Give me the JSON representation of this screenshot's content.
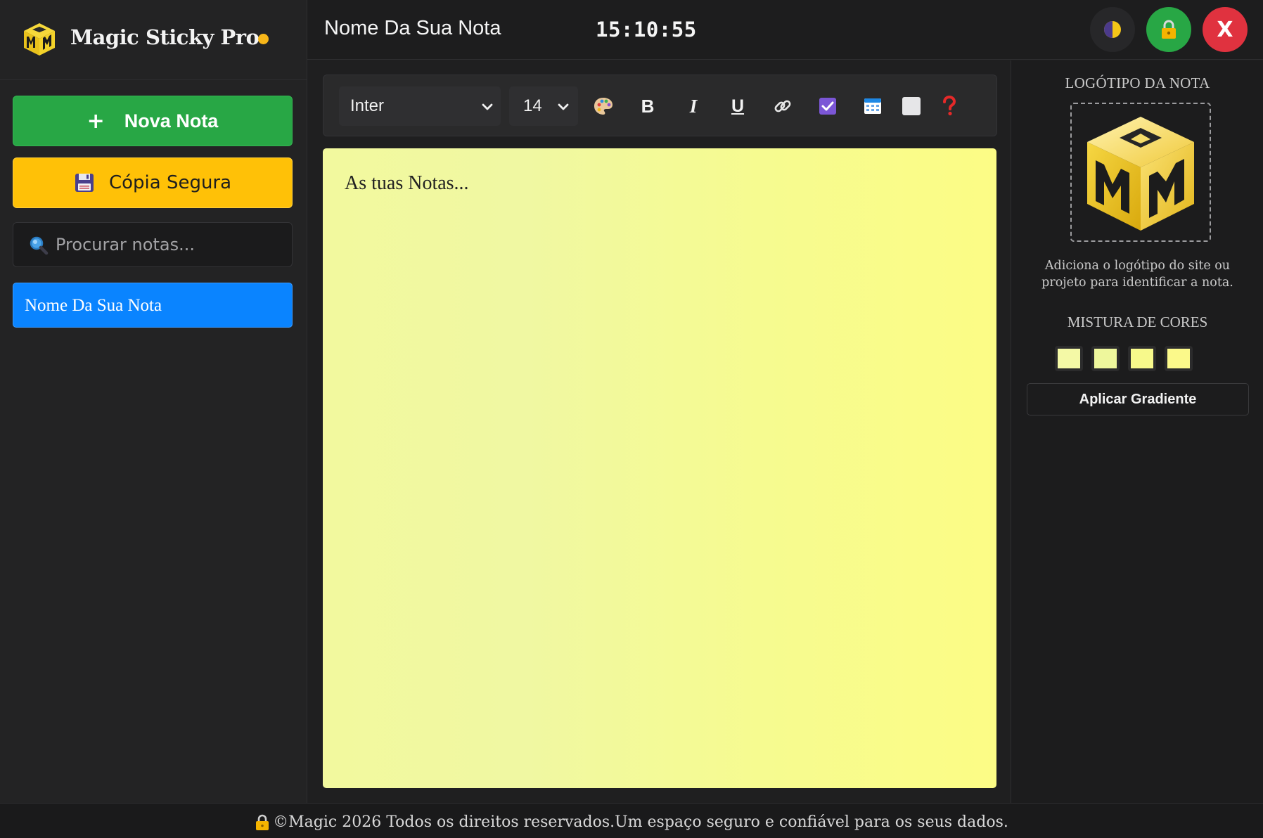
{
  "app": {
    "title": "Magic Sticky Pro",
    "status_dot_color": "#f7b619",
    "logo_icon": "mm-cube-logo-icon"
  },
  "sidebar": {
    "new_note_label": "Nova Nota",
    "new_note_icon": "plus-icon",
    "backup_label": "Cópia Segura",
    "backup_icon": "floppy-disk-icon",
    "search_placeholder": "Procurar notas...",
    "search_icon": "magnifier-icon",
    "notes": [
      {
        "title": "Nome Da Sua Nota",
        "selected": true
      }
    ]
  },
  "header": {
    "note_title": "Nome Da Sua Nota",
    "clock": "15:10:55",
    "theme_icon": "half-moon-icon",
    "lock_icon": "padlock-icon",
    "close_label": "X"
  },
  "toolbar": {
    "font_family": "Inter",
    "font_size": "14",
    "color_icon": "palette-icon",
    "bold_label": "B",
    "italic_label": "I",
    "underline_label": "U",
    "link_icon": "link-icon",
    "checkbox_icon": "checkbox-icon",
    "table_icon": "table-icon",
    "background_icon": "square-icon",
    "help_icon": "question-icon"
  },
  "editor": {
    "placeholder": "As tuas Notas..."
  },
  "right_panel": {
    "logo_heading": "LOGÓTIPO DA NOTA",
    "logo_description": "Adiciona o logótipo do site ou projeto para identificar a nota.",
    "mix_heading": "MISTURA DE CORES",
    "swatches": [
      "#f4f9a6",
      "#eef79c",
      "#f7f98b",
      "#fbf98a"
    ],
    "gradient_button": "Aplicar Gradiente"
  },
  "footer": {
    "text": "©Magic 2026 Todos os direitos reservados.Um espaço seguro e confiável para os seus dados.",
    "lock_icon": "padlock-icon"
  },
  "colors": {
    "accent_green": "#28a745",
    "accent_yellow": "#ffc107",
    "accent_blue": "#0a84ff",
    "accent_red": "#e0323f",
    "note_yellow": "#f6fb90"
  }
}
